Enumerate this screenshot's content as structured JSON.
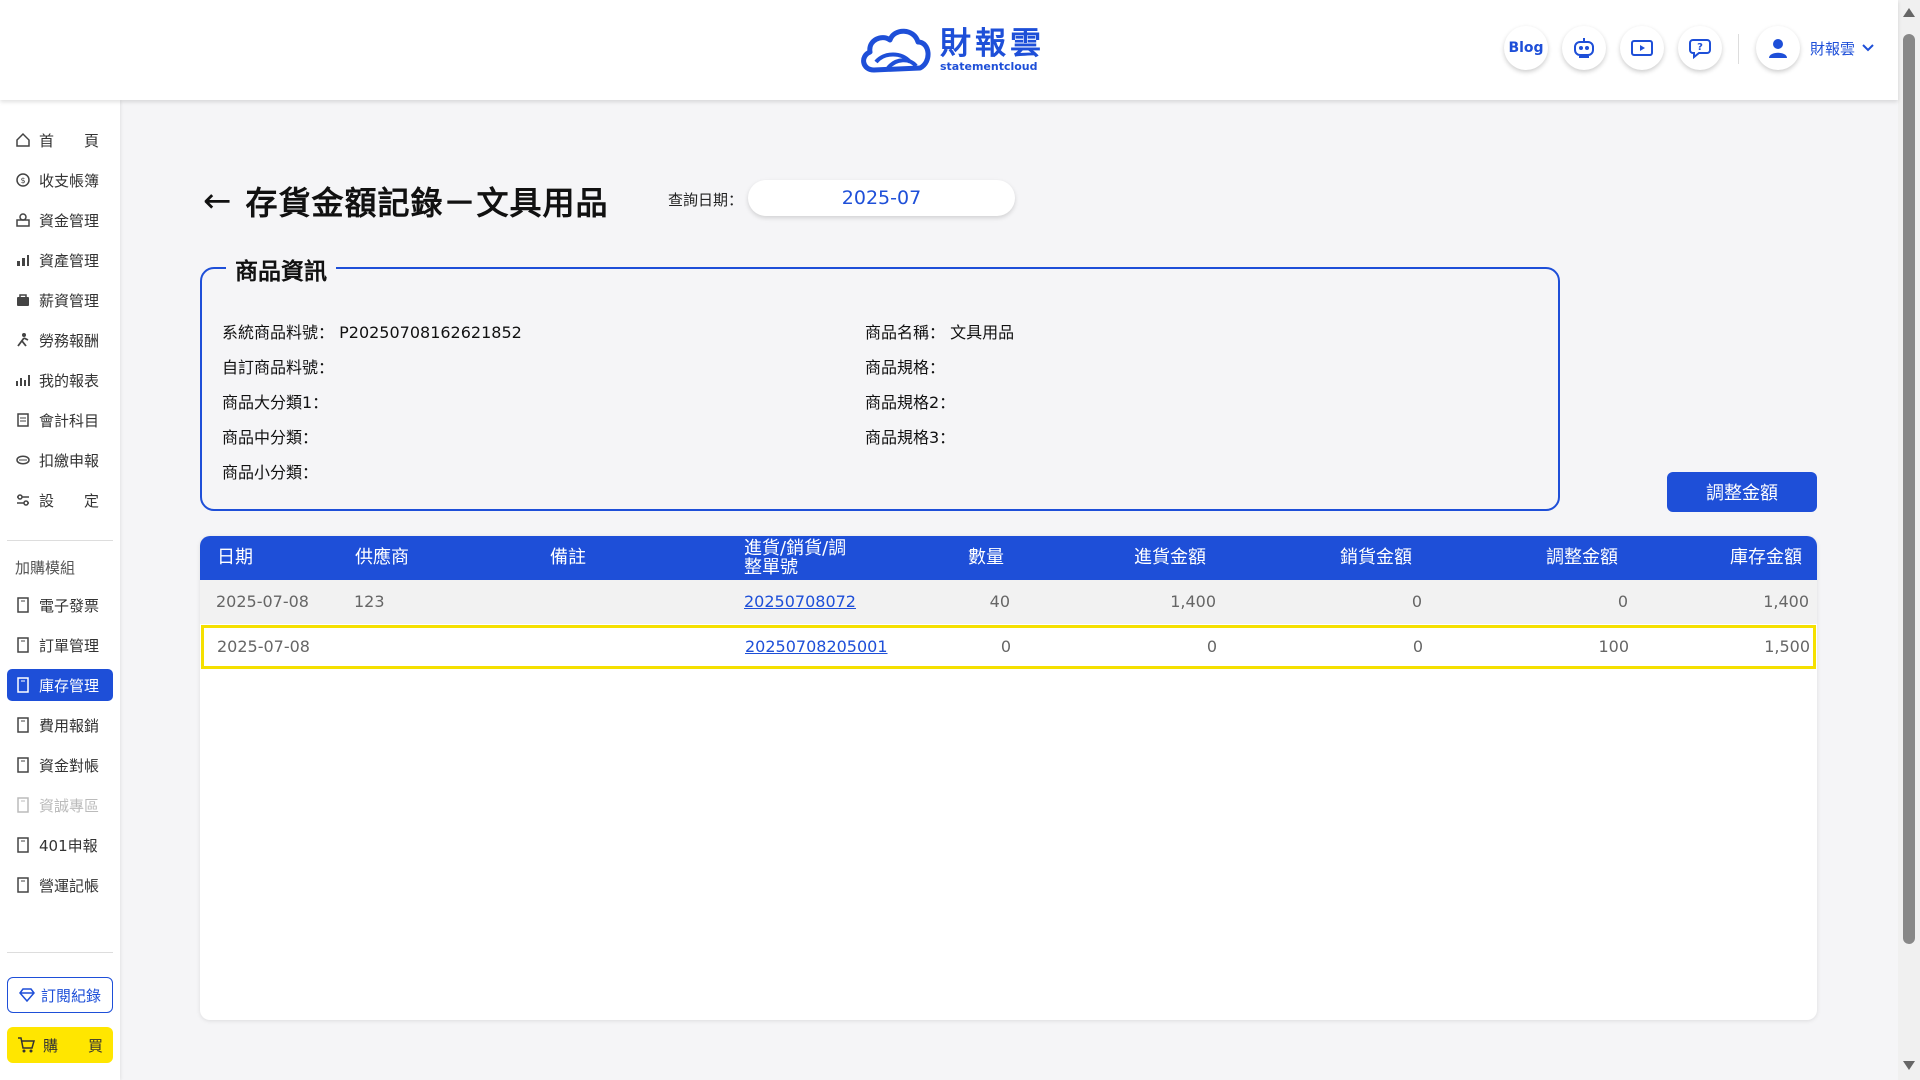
{
  "header": {
    "logo_cn": "財報雲",
    "logo_en": "statementcloud",
    "blog_label": "Blog",
    "icons": [
      "robot-icon",
      "video-icon",
      "support-chat-icon"
    ],
    "user_name": "財報雲"
  },
  "sidebar": {
    "items": [
      {
        "label": "首　　頁",
        "icon": "home-icon"
      },
      {
        "label": "收支帳簿",
        "icon": "coin-icon"
      },
      {
        "label": "資金管理",
        "icon": "fund-icon"
      },
      {
        "label": "資產管理",
        "icon": "asset-icon"
      },
      {
        "label": "薪資管理",
        "icon": "salary-icon"
      },
      {
        "label": "勞務報酬",
        "icon": "labor-icon"
      },
      {
        "label": "我的報表",
        "icon": "report-icon"
      },
      {
        "label": "會計科目",
        "icon": "ledger-icon"
      },
      {
        "label": "扣繳申報",
        "icon": "withholding-icon"
      },
      {
        "label": "設　　定",
        "icon": "settings-icon"
      }
    ],
    "addon_title": "加購模組",
    "addons": [
      {
        "label": "電子發票",
        "state": "normal"
      },
      {
        "label": "訂單管理",
        "state": "normal"
      },
      {
        "label": "庫存管理",
        "state": "active"
      },
      {
        "label": "費用報銷",
        "state": "normal"
      },
      {
        "label": "資金對帳",
        "state": "normal"
      },
      {
        "label": "資誠專區",
        "state": "disabled"
      },
      {
        "label": "401申報",
        "state": "normal"
      },
      {
        "label": "營運記帳",
        "state": "normal"
      }
    ],
    "subscription_label": "訂閱紀錄",
    "buy_label": "購　　買"
  },
  "page": {
    "title": "存貨金額記錄－文具用品",
    "date_label": "查詢日期：",
    "date_value": "2025-07",
    "adjust_button": "調整金額"
  },
  "product_info": {
    "legend": "商品資訊",
    "left": [
      {
        "label": "系統商品料號：",
        "value": "P20250708162621852"
      },
      {
        "label": "自訂商品料號：",
        "value": ""
      },
      {
        "label": "商品大分類1：",
        "value": ""
      },
      {
        "label": "商品中分類：",
        "value": ""
      },
      {
        "label": "商品小分類：",
        "value": ""
      }
    ],
    "right": [
      {
        "label": "商品名稱：",
        "value": "文具用品"
      },
      {
        "label": "商品規格：",
        "value": ""
      },
      {
        "label": "商品規格2：",
        "value": ""
      },
      {
        "label": "商品規格3：",
        "value": ""
      }
    ]
  },
  "table": {
    "headers": {
      "date": "日期",
      "supplier": "供應商",
      "note": "備註",
      "doc_line1": "進貨/銷貨/調",
      "doc_line2": "整單號",
      "qty": "數量",
      "purchase": "進貨金額",
      "sales": "銷貨金額",
      "adjust": "調整金額",
      "stock": "庫存金額"
    },
    "rows": [
      {
        "date": "2025-07-08",
        "supplier": "123",
        "note": "",
        "doc": "20250708072",
        "qty": "40",
        "purchase": "1,400",
        "sales": "0",
        "adjust": "0",
        "stock": "1,400"
      },
      {
        "date": "2025-07-08",
        "supplier": "",
        "note": "",
        "doc": "20250708205001",
        "qty": "0",
        "purchase": "0",
        "sales": "0",
        "adjust": "100",
        "stock": "1,500"
      }
    ]
  },
  "colors": {
    "primary": "#1e4fd8",
    "highlight": "#f5e000",
    "buy": "#ffe600"
  }
}
